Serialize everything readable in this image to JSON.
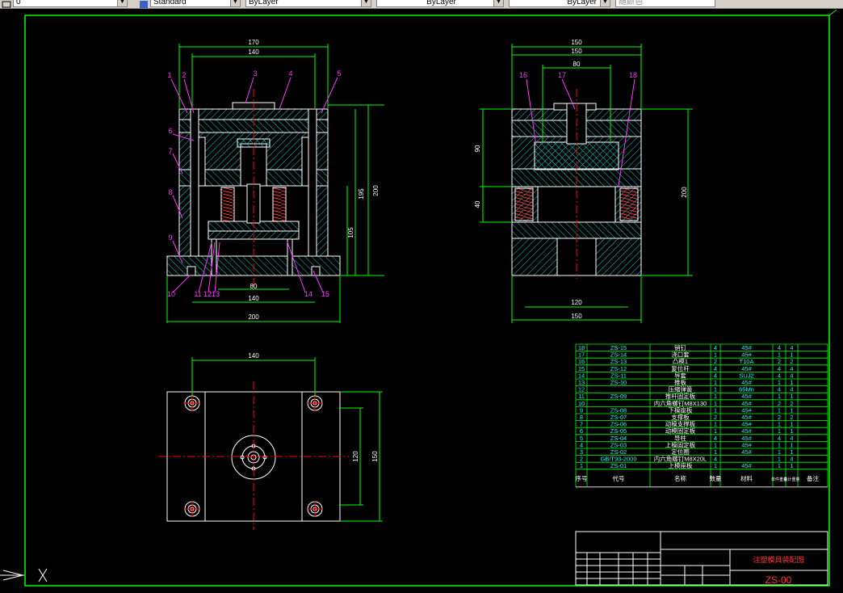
{
  "toolbar": {
    "layer_value": "0",
    "text_style": "Standard",
    "color": "ByLayer",
    "linetype": "ByLayer",
    "lineweight": "ByLayer",
    "plot_style": "随颜色"
  },
  "front_view": {
    "dims": {
      "d170": "170",
      "d140": "140",
      "d195": "195",
      "d200": "200",
      "d105": "105",
      "d80": "80",
      "d140b": "140",
      "d200b": "200"
    },
    "callouts": [
      "1",
      "2",
      "3",
      "4",
      "5",
      "6",
      "7",
      "8",
      "9",
      "10",
      "11",
      "12",
      "13",
      "14",
      "15"
    ]
  },
  "side_view": {
    "dims": {
      "d150a": "150",
      "d150b": "150",
      "d80": "80",
      "d90": "90",
      "d40": "40",
      "d200": "200",
      "d120": "120",
      "d150c": "150"
    },
    "callouts": [
      "16",
      "17",
      "18"
    ]
  },
  "top_view": {
    "dims": {
      "d140": "140",
      "d120": "120",
      "d150": "150"
    }
  },
  "bom": {
    "rows": [
      {
        "no": "18",
        "code": "ZS-15",
        "name": "销钉",
        "qty": "4",
        "mat": "45#",
        "a": "4",
        "b": "4"
      },
      {
        "no": "17",
        "code": "ZS-14",
        "name": "浇口套",
        "qty": "1",
        "mat": "45#",
        "a": "1",
        "b": "1"
      },
      {
        "no": "16",
        "code": "ZS-13",
        "name": "凸模1",
        "qty": "2",
        "mat": "T10A",
        "a": "2",
        "b": "2"
      },
      {
        "no": "15",
        "code": "ZS-12",
        "name": "复位杆",
        "qty": "4",
        "mat": "45#",
        "a": "4",
        "b": "4"
      },
      {
        "no": "14",
        "code": "ZS-11",
        "name": "导套",
        "qty": "4",
        "mat": "SUJ2",
        "a": "4",
        "b": "4"
      },
      {
        "no": "13",
        "code": "ZS-10",
        "name": "推板",
        "qty": "1",
        "mat": "45#",
        "a": "1",
        "b": "1"
      },
      {
        "no": "12",
        "code": "",
        "name": "压缩弹簧",
        "qty": "1",
        "mat": "65Mn",
        "a": "4",
        "b": "4"
      },
      {
        "no": "11",
        "code": "ZS-09",
        "name": "推杆固定板",
        "qty": "1",
        "mat": "45#",
        "a": "1",
        "b": "1"
      },
      {
        "no": "10",
        "code": "",
        "name": "内六角螺钉M8X130",
        "qty": "1",
        "mat": "45#",
        "a": "2",
        "b": "2"
      },
      {
        "no": "9",
        "code": "ZS-08",
        "name": "下模座板",
        "qty": "1",
        "mat": "45#",
        "a": "1",
        "b": "1"
      },
      {
        "no": "8",
        "code": "ZS-07",
        "name": "支撑板",
        "qty": "2",
        "mat": "45#",
        "a": "2",
        "b": "2"
      },
      {
        "no": "7",
        "code": "ZS-06",
        "name": "动模支撑板",
        "qty": "1",
        "mat": "45#",
        "a": "1",
        "b": "1"
      },
      {
        "no": "6",
        "code": "ZS-05",
        "name": "动模固定板",
        "qty": "1",
        "mat": "45#",
        "a": "1",
        "b": "1"
      },
      {
        "no": "5",
        "code": "ZS-04",
        "name": "导柱",
        "qty": "4",
        "mat": "45#",
        "a": "4",
        "b": "4"
      },
      {
        "no": "4",
        "code": "ZS-03",
        "name": "上模固定板",
        "qty": "1",
        "mat": "45#",
        "a": "1",
        "b": "1"
      },
      {
        "no": "3",
        "code": "ZS-02",
        "name": "定位圈",
        "qty": "1",
        "mat": "45#",
        "a": "1",
        "b": "1"
      },
      {
        "no": "2",
        "code": "GB/T93-2000",
        "name": "内六角螺钉M8X20L",
        "qty": "4",
        "mat": "",
        "a": "1",
        "b": "4"
      },
      {
        "no": "1",
        "code": "ZS-01",
        "name": "上模座板",
        "qty": "1",
        "mat": "45#",
        "a": "1",
        "b": "1"
      }
    ],
    "header": {
      "no": "序号",
      "code": "代号",
      "name": "名称",
      "qty": "数量",
      "mat": "材料",
      "a": "单件重量",
      "b": "总计重量",
      "remark": "备注"
    }
  },
  "title_block": {
    "title": "注塑模具装配图",
    "drawing_no": "ZS-00"
  },
  "colors": {
    "background": "#000000",
    "geometry": "#ffffff",
    "dimension": "#00ff00",
    "callout": "#ff33ff",
    "center": "#ff0000",
    "hatch": "#00ffff",
    "bom_text": "#00ffff",
    "border": "#00ff00"
  }
}
